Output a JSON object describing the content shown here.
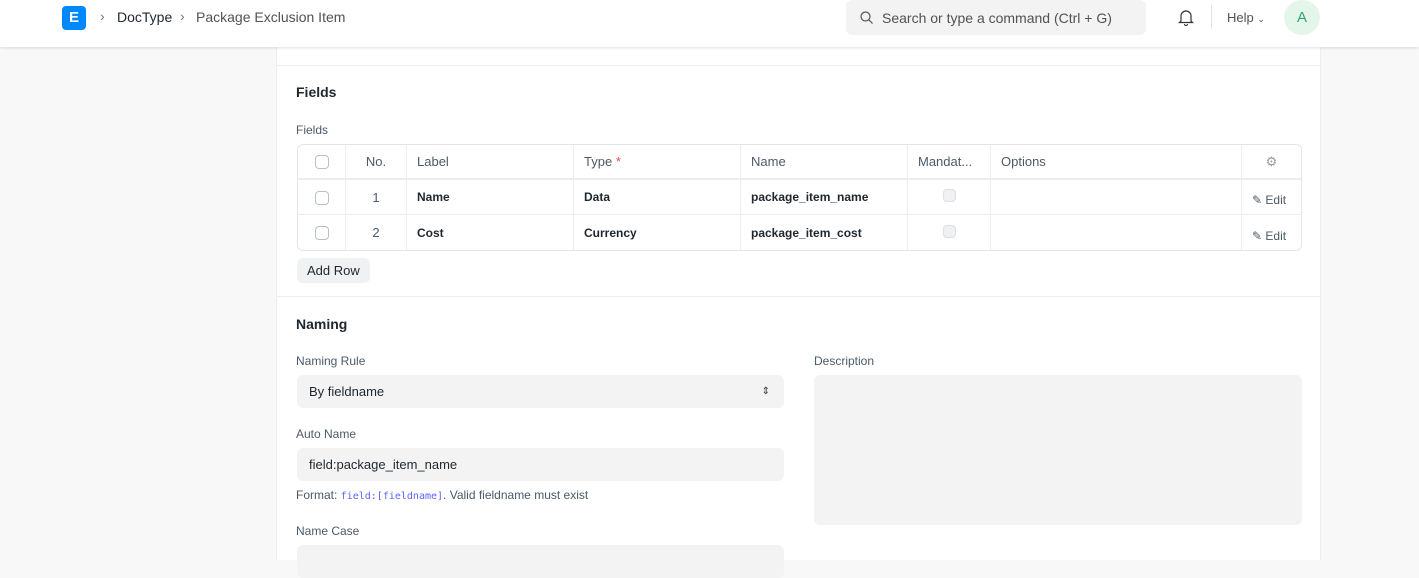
{
  "nav": {
    "logo": "E",
    "breadcrumbs": [
      "DocType",
      "Package Exclusion Item"
    ],
    "search_placeholder": "Search or type a command (Ctrl + G)",
    "help": "Help",
    "avatar": "A"
  },
  "fields_section": {
    "title": "Fields",
    "table_label": "Fields",
    "columns": [
      "No.",
      "Label",
      "Type",
      "Name",
      "Mandat...",
      "Options"
    ],
    "required_mark": "*",
    "rows": [
      {
        "no": "1",
        "label": "Name",
        "type": "Data",
        "name": "package_item_name",
        "edit": "Edit"
      },
      {
        "no": "2",
        "label": "Cost",
        "type": "Currency",
        "name": "package_item_cost",
        "edit": "Edit"
      }
    ],
    "add_row": "Add Row"
  },
  "naming": {
    "title": "Naming",
    "naming_rule_label": "Naming Rule",
    "naming_rule_value": "By fieldname",
    "auto_name_label": "Auto Name",
    "auto_name_value": "field:package_item_name",
    "format_prefix": "Format: ",
    "format_code": "field:[fieldname]",
    "format_suffix": ". Valid fieldname must exist",
    "name_case_label": "Name Case",
    "description_label": "Description"
  }
}
